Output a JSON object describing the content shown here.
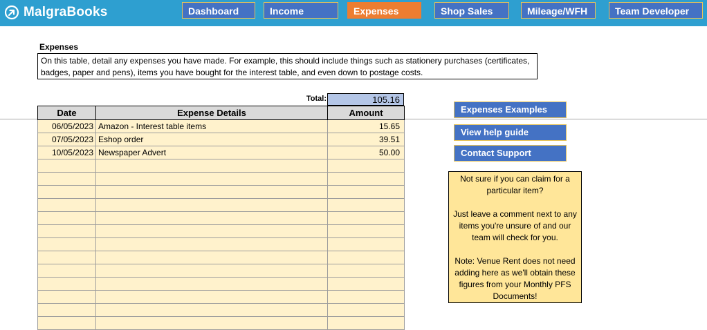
{
  "app": {
    "name": "MalgraBooks"
  },
  "nav": [
    {
      "label": "Dashboard",
      "active": false
    },
    {
      "label": "Income",
      "active": false
    },
    {
      "label": "Expenses",
      "active": true
    },
    {
      "label": "Shop Sales",
      "active": false
    },
    {
      "label": "Mileage/WFH",
      "active": false
    },
    {
      "label": "Team Developer",
      "active": false
    }
  ],
  "section": {
    "title": "Expenses",
    "intro": "On this table, detail any expenses you have made. For example, this should include things such as stationery purchases (certificates, badges, paper and pens), items you have bought for the interest table, and even down to postage costs."
  },
  "total": {
    "label": "Total:",
    "value": "105.16"
  },
  "table": {
    "headers": [
      "Date",
      "Expense Details",
      "Amount"
    ],
    "rows": [
      {
        "date": "06/05/2023",
        "details": "Amazon - Interest table items",
        "amount": "15.65"
      },
      {
        "date": "07/05/2023",
        "details": "Eshop order",
        "amount": "39.51"
      },
      {
        "date": "10/05/2023",
        "details": "Newspaper Advert",
        "amount": "50.00"
      },
      {
        "date": "",
        "details": "",
        "amount": ""
      },
      {
        "date": "",
        "details": "",
        "amount": ""
      },
      {
        "date": "",
        "details": "",
        "amount": ""
      },
      {
        "date": "",
        "details": "",
        "amount": ""
      },
      {
        "date": "",
        "details": "",
        "amount": ""
      },
      {
        "date": "",
        "details": "",
        "amount": ""
      },
      {
        "date": "",
        "details": "",
        "amount": ""
      },
      {
        "date": "",
        "details": "",
        "amount": ""
      },
      {
        "date": "",
        "details": "",
        "amount": ""
      },
      {
        "date": "",
        "details": "",
        "amount": ""
      },
      {
        "date": "",
        "details": "",
        "amount": ""
      },
      {
        "date": "",
        "details": "",
        "amount": ""
      },
      {
        "date": "",
        "details": "",
        "amount": ""
      }
    ]
  },
  "side_buttons": {
    "examples": "Expenses Examples",
    "help": "View help guide",
    "support": "Contact Support"
  },
  "note": {
    "line1": "Not sure if you can claim for a particular item?",
    "line2": "Just leave a comment next to any items you're unsure of and our team will check for you.",
    "line3": "Note: Venue Rent does not need adding here as we'll obtain these figures from your Monthly PFS Documents!"
  },
  "colors": {
    "header_bg": "#2e9fd0",
    "nav_bg": "#4472c4",
    "nav_active": "#ed7d31",
    "row_bg": "#fff2cc",
    "note_bg": "#ffe699",
    "total_bg": "#b4c6e7"
  },
  "icons": {
    "logo": "arrow-circle-icon"
  }
}
